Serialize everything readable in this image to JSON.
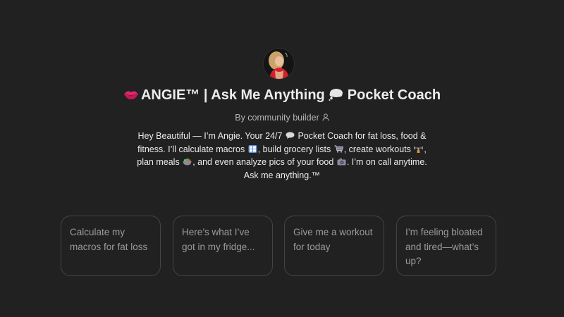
{
  "gpt": {
    "title": "ANGIE™ | Ask Me Anything",
    "title_suffix": "Pocket Coach",
    "byline": "By community builder",
    "description_parts": [
      "Hey Beautiful — I’m Angie. Your 24/7",
      "Pocket Coach for fat loss, food & fitness. I’ll calculate macros",
      ", build grocery lists",
      ", create workouts",
      ", plan meals",
      ", and even analyze pics of your food",
      ". I’m on call anytime. Ask me anything.™"
    ]
  },
  "icons": {
    "title_prefix": "lips-icon",
    "title_bubble": "thought-bubble-icon",
    "byline": "person-icon",
    "description": [
      "speech-bubble-icon",
      "numbers-icon",
      "cart-icon",
      "weightlifter-icon",
      "salad-bowl-icon",
      "camera-icon"
    ]
  },
  "conversation_starters": [
    "Calculate my macros for fat loss",
    "Here’s what I’ve got in my fridge...",
    "Give me a workout for today",
    "I’m feeling bloated and tired—what’s up?"
  ],
  "colors": {
    "background": "#212121",
    "card_border": "#444444",
    "muted_text": "#9b9b9b",
    "accent_red": "#d3202c"
  }
}
